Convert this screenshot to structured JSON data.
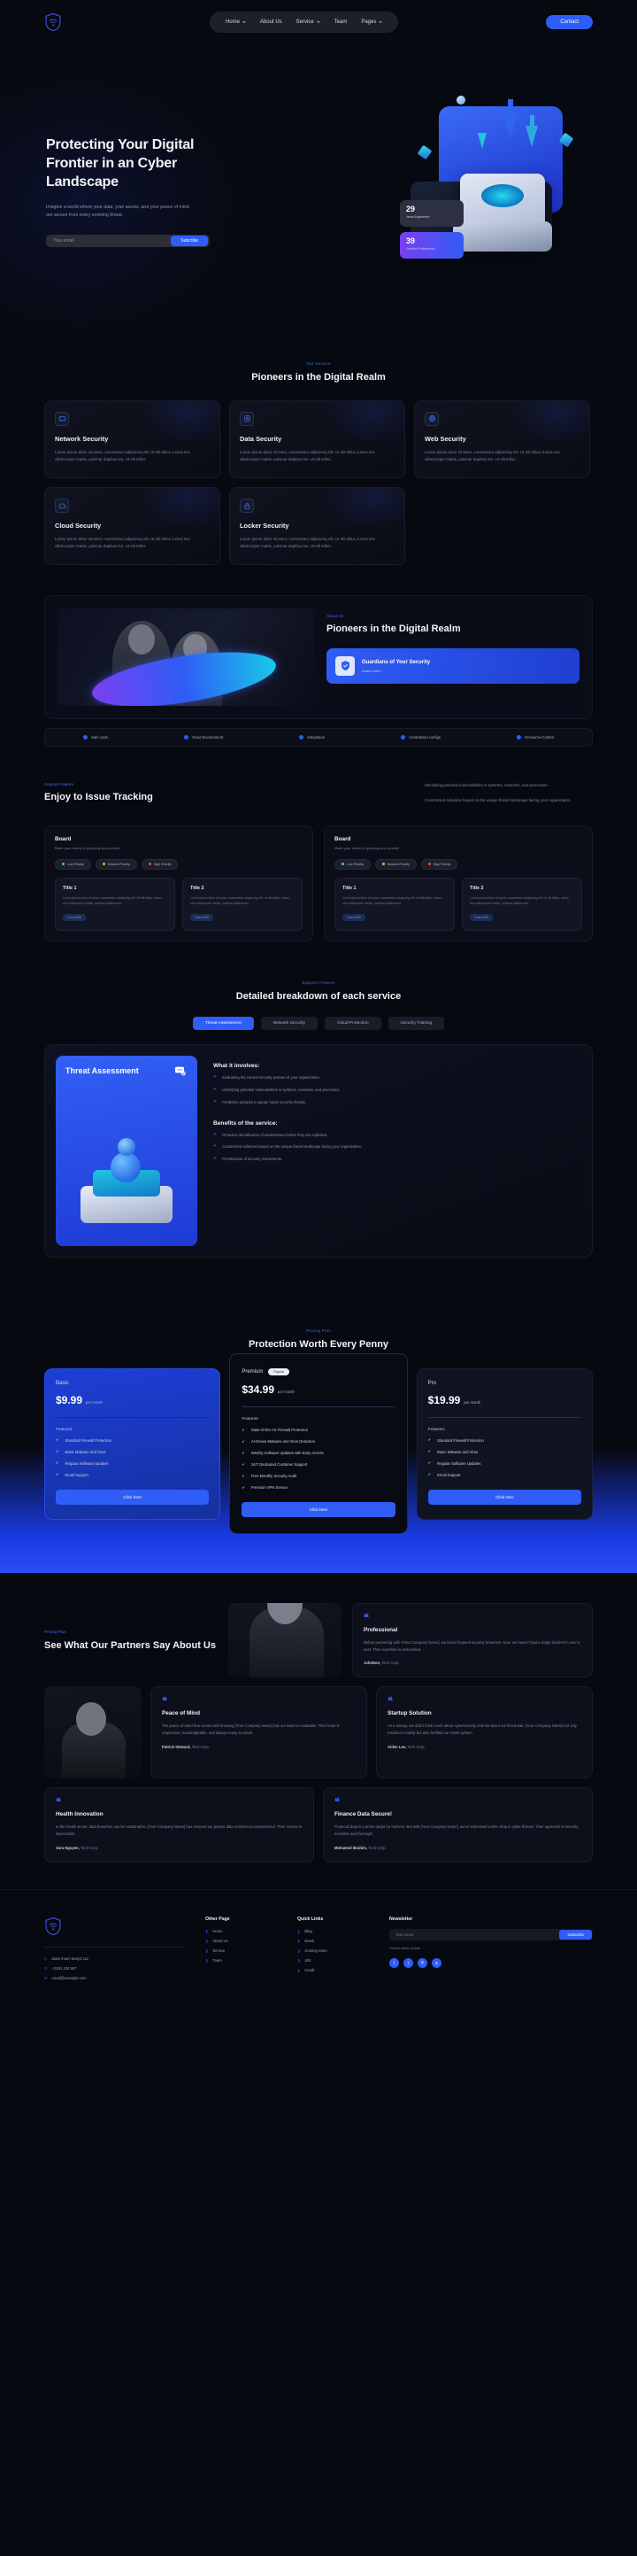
{
  "nav": {
    "logo": "shield-wifi-logo",
    "items": [
      {
        "label": "Home",
        "caret": true
      },
      {
        "label": "About Us",
        "caret": false
      },
      {
        "label": "Service",
        "caret": true
      },
      {
        "label": "Team",
        "caret": false
      },
      {
        "label": "Pages",
        "caret": true
      }
    ],
    "cta": "Contact"
  },
  "hero": {
    "title": "Protecting Your Digital Frontier in an Cyber Landscape",
    "paragraph": "Imagine a world where your data, your assets, and your peace of mind are secure from every evolving threat.",
    "email_placeholder": "Your email",
    "subscribe": "Subcribe",
    "stats": [
      {
        "number": "29",
        "label": "Years Experience"
      },
      {
        "number": "39",
        "label": "Certified Professional"
      }
    ]
  },
  "services": {
    "tag": "Our Service",
    "title": "Pioneers in the Digital Realm",
    "body": "Lorem ipsum dolor sit amet, consectetur adipiscing elit. Ut elit tellus, luctus nec ullamcorper mattis, pulvinar dapibus leo. Ut elit tellus.",
    "cards": [
      {
        "icon": "network-icon",
        "name": "Network Security"
      },
      {
        "icon": "data-icon",
        "name": "Data Security"
      },
      {
        "icon": "web-icon",
        "name": "Web Security"
      },
      {
        "icon": "cloud-icon",
        "name": "Cloud Security"
      },
      {
        "icon": "locker-icon",
        "name": "Locker Security"
      }
    ]
  },
  "about": {
    "tag": "About Us",
    "title": "Pioneers in the Digital Realm",
    "cta_title": "Guardians of Your Security",
    "cta_sub": "Learn more  ›",
    "features": [
      {
        "label": "Safe code"
      },
      {
        "label": "Good Environment"
      },
      {
        "label": "Integration"
      },
      {
        "label": "Centralized configs"
      },
      {
        "label": "Resource Control"
      }
    ]
  },
  "issues": {
    "tag": "Support Feature",
    "title": "Enjoy to Issue Tracking",
    "paragraph1": "Identifying potential vulnerabilities in systems, networks, and processes.",
    "paragraph2": "Customized solutions based on the unique threat landscape facing your organization.",
    "boards": [
      {
        "title": "Board",
        "subtitle": "Make your board to grouping your priority",
        "chips": [
          {
            "label": "Low Priority",
            "color": "#4ad08a"
          },
          {
            "label": "Medium Priority",
            "color": "#e8b23d"
          },
          {
            "label": "High Priority",
            "color": "#e2553d"
          }
        ],
        "cards": [
          {
            "title": "Title 1",
            "body": "Lorem ipsum dolor sit amet, consectetur adipiscing elit. Ut elit tellus, luctus nec ullamcorper mattis, pulvinar dapibus leo.",
            "tag": "3 Jan 2025"
          },
          {
            "title": "Title 2",
            "body": "Lorem ipsum dolor sit amet, consectetur adipiscing elit. Ut elit tellus, luctus nec ullamcorper mattis, pulvinar dapibus leo.",
            "tag": "3 Jan 2025"
          }
        ]
      },
      {
        "title": "Board",
        "subtitle": "Make your board to grouping your priority",
        "chips": [
          {
            "label": "Low Priority",
            "color": "#4ad08a"
          },
          {
            "label": "Medium Priority",
            "color": "#e8b23d"
          },
          {
            "label": "High Priority",
            "color": "#e2553d"
          }
        ],
        "cards": [
          {
            "title": "Title 1",
            "body": "Lorem ipsum dolor sit amet, consectetur adipiscing elit. Ut elit tellus, luctus nec ullamcorper mattis, pulvinar dapibus leo.",
            "tag": "3 Jan 2025"
          },
          {
            "title": "Title 2",
            "body": "Lorem ipsum dolor sit amet, consectetur adipiscing elit. Ut elit tellus, luctus nec ullamcorper mattis, pulvinar dapibus leo.",
            "tag": "3 Jan 2025"
          }
        ]
      }
    ]
  },
  "breakdown": {
    "tag": "Support Feature",
    "title": "Detailed breakdown of each service",
    "tabs": [
      {
        "label": "Threat Assessment",
        "active": true
      },
      {
        "label": "Network Security",
        "active": false
      },
      {
        "label": "Cloud Protection",
        "active": false
      },
      {
        "label": "Security Training",
        "active": false
      }
    ],
    "panel_title": "Threat Assessment",
    "involves_heading": "What it involves:",
    "involves": [
      "Evaluating the current security posture of your organization.",
      "Identifying potential vulnerabilities in systems, networks, and processes.",
      "Predictive analysis to gauge future security threats."
    ],
    "benefits_heading": "Benefits of the service:",
    "benefits": [
      "Proactive identification of weaknesses before they are exploited.",
      "Customized solutions based on the unique threat landscape facing your organization.",
      "Prioritization of security investments."
    ]
  },
  "pricing": {
    "tag": "Pricing Plan",
    "title": "Protection Worth Every Penny",
    "plans": [
      {
        "name": "Basic",
        "badge": "",
        "price": "$9.99",
        "period": "per month",
        "features_label": "Features:",
        "features": [
          "Standard Firewall Protection",
          "Basic Malware and Virus",
          "Regular Software Updates",
          "Email Support"
        ],
        "button": "Click here"
      },
      {
        "name": "Premium",
        "badge": "Popular",
        "price": "$34.99",
        "period": "per month",
        "features_label": "Features:",
        "features": [
          "State-of-the-Art Firewall Protection",
          "AI-Driven Malware and Virus Detection",
          "Weekly Software Updates with Early Access",
          "24/7 Dedicated Customer Support",
          "Free Monthly Security Audit",
          "Premium VPN Service"
        ],
        "button": "Click here"
      },
      {
        "name": "Pro",
        "badge": "",
        "price": "$19.99",
        "period": "per month",
        "features_label": "Features:",
        "features": [
          "Standard Firewall Protection",
          "Basic Malware and Virus",
          "Regular Software Updates",
          "Email Support"
        ],
        "button": "Click here"
      }
    ]
  },
  "testimonials": {
    "tag": "Pricing Plan",
    "title": "See What Our Partners Say About Us",
    "main": {
      "heading": "Professional",
      "body": "Before partnering with 1Your Company Name], we faced frequent security breaches. Now, we haven't had a single incident in over a year. Their expertise is unmatched.",
      "author": "JohnDoe,",
      "company": "Tech Corp."
    },
    "mid": {
      "heading": "Peace of Mind",
      "body": "The peace of mind that comes with knowing [Your Company Name] has our back is invaluable. Their team is responsive, knowledgeable, and always ready to assist.",
      "author": "Patrick Steward,",
      "company": "Tech Corp."
    },
    "mid2": {
      "heading": "Startup Solution",
      "body": "As a startup, we didn't think much about cybersecurity until we faced our first break. [Your Company Name] not only resolved it swiftly but also fortified our entire system.",
      "author": "Aiden Lee,",
      "company": "Tech Corp."
    },
    "bottom": [
      {
        "heading": "Health Innovation",
        "body": "In the health sector, data breaches can be catastrophic. [Your Company Name] has ensured our patient data remains uncompromised. Their service is impeccable.",
        "author": "Sara Nguyen,",
        "company": "Tech Corp."
      },
      {
        "heading": "Finance Data Secure!",
        "body": "Financial data is a prime target for hackers. But with [Your Company Name], we've witnessed a 90% drop in cyber threats. Their approach to security is holistic and thorough.",
        "author": "Mohamed Ibrahim,",
        "company": "Tech Corp."
      }
    ]
  },
  "footer": {
    "address": "Jalan Imam Bonjol 111",
    "phone": "+2381 234 567",
    "email": "email@example.com",
    "other_page": {
      "title": "Other Page",
      "links": [
        "Home",
        "About Us",
        "Service",
        "Team"
      ]
    },
    "quick_links": {
      "title": "Quick Links",
      "links": [
        "Blog",
        "News",
        "Coming Soon",
        "404",
        "Credit"
      ]
    },
    "newsletter": {
      "title": "Newsletter",
      "placeholder": "Your email",
      "button": "Subscribe",
      "note": "Get the latest update"
    },
    "socials": [
      "facebook-icon",
      "twitter-icon",
      "instagram-icon",
      "linkedin-icon"
    ]
  }
}
